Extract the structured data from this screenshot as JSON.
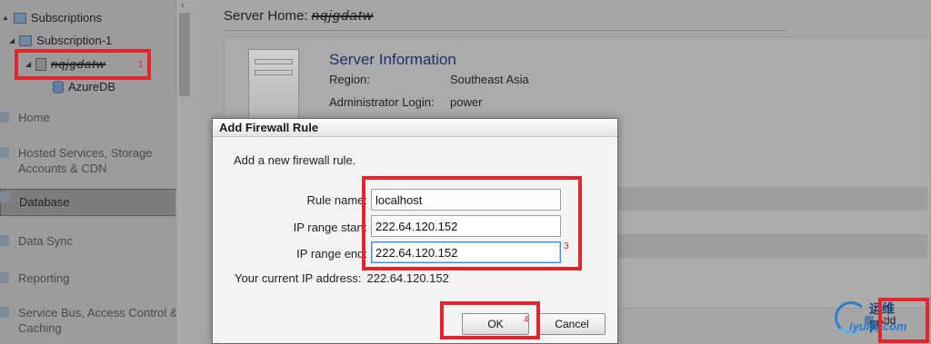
{
  "sidebar": {
    "tree": {
      "subscriptions_label": "Subscriptions",
      "subscription_label": "Subscription-1",
      "server_name": "nqjgdatw",
      "database_label": "AzureDB"
    },
    "nav_items": [
      {
        "label": "Home"
      },
      {
        "label": "Hosted Services, Storage Accounts & CDN"
      },
      {
        "label": "Database"
      },
      {
        "label": "Data Sync"
      },
      {
        "label": "Reporting"
      },
      {
        "label": "Service Bus, Access Control & Caching"
      }
    ]
  },
  "main": {
    "server_home_label": "Server Home:",
    "server_home_name": "nqjgdatw",
    "info_title": "Server Information",
    "region_label": "Region:",
    "region_value": "Southeast Asia",
    "admin_label": "Administrator Login:",
    "admin_value": "power",
    "add_label": "Add"
  },
  "dialog": {
    "title": "Add Firewall Rule",
    "intro": "Add a new firewall rule.",
    "rule_name_label": "Rule name:",
    "rule_name_value": "localhost",
    "ip_start_label": "IP range start:",
    "ip_start_value": "222.64.120.152",
    "ip_end_label": "IP range end:",
    "ip_end_value": "222.64.120.152",
    "current_ip_label": "Your current IP address:",
    "current_ip_value": "222.64.120.152",
    "ok_label": "OK",
    "cancel_label": "Cancel"
  },
  "annotations": [
    "1",
    "3",
    "4",
    "1"
  ],
  "watermark": {
    "cn": "运维网",
    "domain": "iyunv.com"
  },
  "colors": {
    "annotation": "#e1262c",
    "info_title": "#1f2f66",
    "focus_border": "#3b8ee0"
  }
}
